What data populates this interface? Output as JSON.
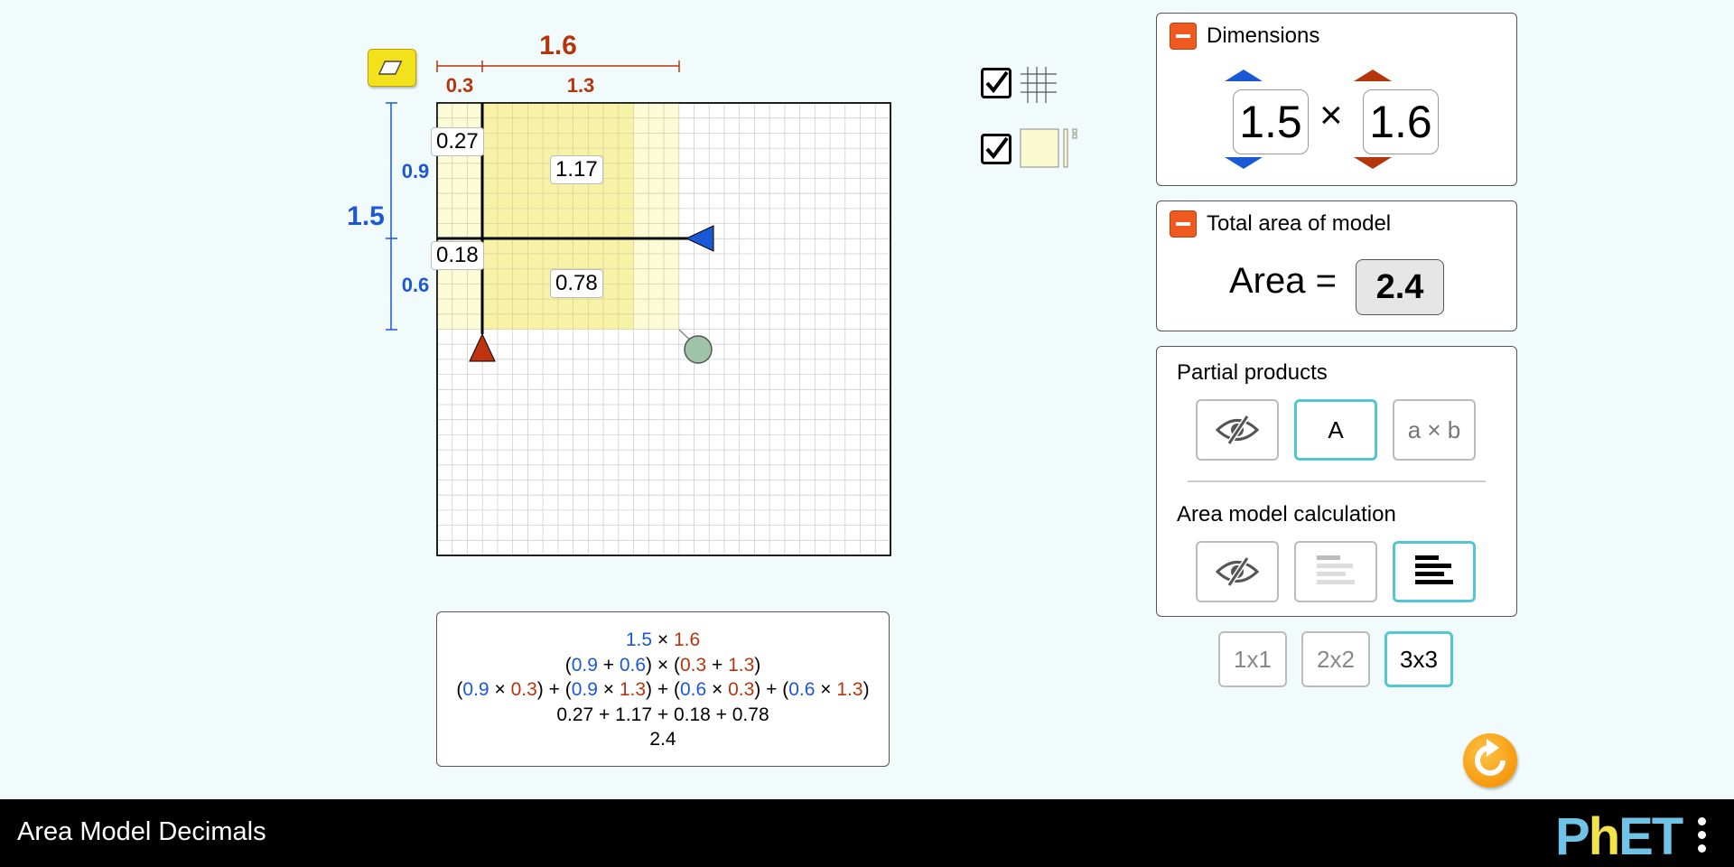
{
  "app": {
    "title": "Area Model Decimals"
  },
  "model": {
    "width_total": "1.6",
    "width_parts": [
      "0.3",
      "1.3"
    ],
    "height_total": "1.5",
    "height_parts": [
      "0.9",
      "0.6"
    ],
    "partial_products": {
      "tl": "0.27",
      "tr": "1.17",
      "bl": "0.18",
      "br": "0.78"
    },
    "colors": {
      "horizontal": "#1b58d6",
      "vertical": "#b5350d",
      "fill": "#f7f1a2",
      "fill_light": "#fafad0"
    }
  },
  "toggles": {
    "grid_checked": true,
    "tiles_checked": true
  },
  "dimensions_panel": {
    "title": "Dimensions",
    "factor_a": "1.5",
    "times": "×",
    "factor_b": "1.6"
  },
  "area_panel": {
    "title": "Total area of model",
    "label": "Area =",
    "value": "2.4"
  },
  "partial_products_panel": {
    "title": "Partial products",
    "options": [
      "hide",
      "A",
      "a × b"
    ],
    "selected": "A"
  },
  "area_calc_panel": {
    "title": "Area model calculation",
    "options": [
      "hide",
      "line-by-line",
      "all-lines"
    ],
    "selected": "all-lines"
  },
  "grid_options": {
    "options": [
      "1x1",
      "2x2",
      "3x3"
    ],
    "selected": "3x3"
  },
  "calculation": {
    "line1": {
      "a": "1.5",
      "op": "×",
      "b": "1.6"
    },
    "line2": {
      "h1": "0.9",
      "h2": "0.6",
      "v1": "0.3",
      "v2": "1.3"
    },
    "line3": [
      {
        "h": "0.9",
        "v": "0.3"
      },
      {
        "h": "0.9",
        "v": "1.3"
      },
      {
        "h": "0.6",
        "v": "0.3"
      },
      {
        "h": "0.6",
        "v": "1.3"
      }
    ],
    "line4": "0.27 + 1.17 + 0.18 + 0.78",
    "line5": "2.4"
  }
}
